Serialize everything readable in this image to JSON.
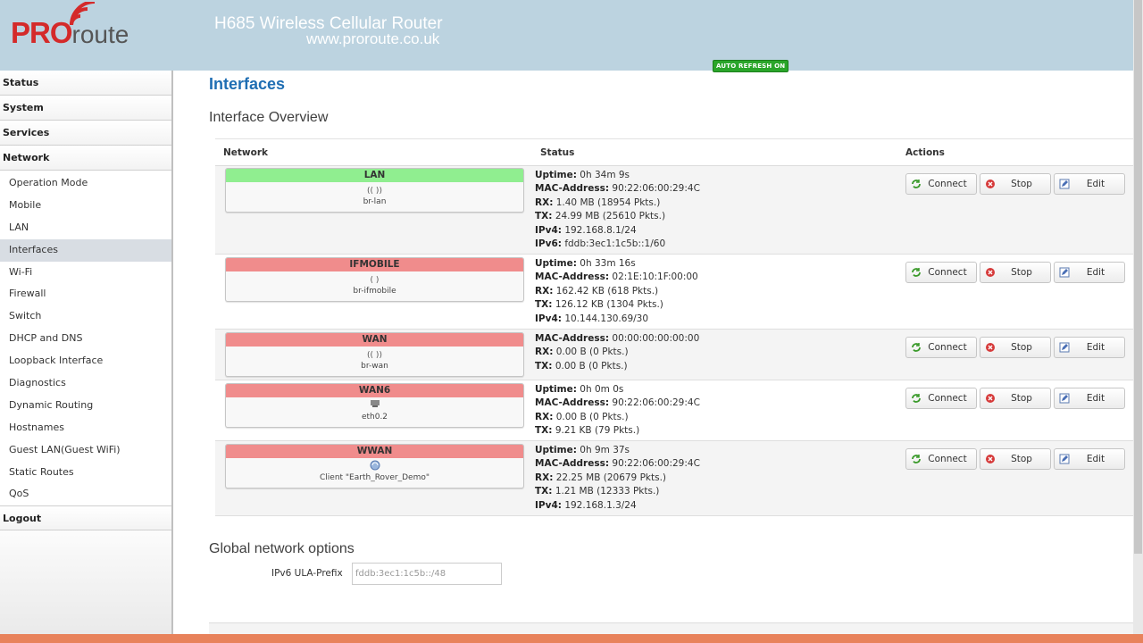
{
  "header": {
    "logo_pro": "PRO",
    "logo_route": "route",
    "title": "H685 Wireless Cellular Router",
    "url": "www.proroute.co.uk",
    "auto_refresh": "AUTO REFRESH ON",
    "colors": {
      "header_bg": "#bcd3e0",
      "brand_red": "#d42a2a",
      "auto_refresh_bg": "#2aa52a"
    }
  },
  "sidebar": {
    "status": "Status",
    "system": "System",
    "services": "Services",
    "network": "Network",
    "network_items": [
      "Operation Mode",
      "Mobile",
      "LAN",
      "Interfaces",
      "Wi-Fi",
      "Firewall",
      "Switch",
      "DHCP and DNS",
      "Loopback Interface",
      "Diagnostics",
      "Dynamic Routing",
      "Hostnames",
      "Guest LAN(Guest WiFi)",
      "Static Routes",
      "QoS"
    ],
    "active_item": "Interfaces",
    "logout": "Logout"
  },
  "main": {
    "page_title": "Interfaces",
    "overview_title": "Interface Overview",
    "columns": {
      "network": "Network",
      "status": "Status",
      "actions": "Actions"
    },
    "buttons": {
      "connect": "Connect",
      "stop": "Stop",
      "edit": "Edit"
    },
    "interfaces": [
      {
        "name": "LAN",
        "head_color": "#90ee90",
        "icons": "(( ))",
        "device": "br-lan",
        "status": [
          {
            "k": "Uptime",
            "v": "0h 34m 9s"
          },
          {
            "k": "MAC-Address",
            "v": "90:22:06:00:29:4C"
          },
          {
            "k": "RX",
            "v": "1.40 MB (18954 Pkts.)"
          },
          {
            "k": "TX",
            "v": "24.99 MB (25610 Pkts.)"
          },
          {
            "k": "IPv4",
            "v": "192.168.8.1/24"
          },
          {
            "k": "IPv6",
            "v": "fddb:3ec1:1c5b::1/60"
          }
        ]
      },
      {
        "name": "IFMOBILE",
        "head_color": "#f08c8c",
        "icons": "( )",
        "device": "br-ifmobile",
        "status": [
          {
            "k": "Uptime",
            "v": "0h 33m 16s"
          },
          {
            "k": "MAC-Address",
            "v": "02:1E:10:1F:00:00"
          },
          {
            "k": "RX",
            "v": "162.42 KB (618 Pkts.)"
          },
          {
            "k": "TX",
            "v": "126.12 KB (1304 Pkts.)"
          },
          {
            "k": "IPv4",
            "v": "10.144.130.69/30"
          }
        ]
      },
      {
        "name": "WAN",
        "head_color": "#f08c8c",
        "icons": "(( ))",
        "device": "br-wan",
        "status": [
          {
            "k": "MAC-Address",
            "v": "00:00:00:00:00:00"
          },
          {
            "k": "RX",
            "v": "0.00 B (0 Pkts.)"
          },
          {
            "k": "TX",
            "v": "0.00 B (0 Pkts.)"
          }
        ]
      },
      {
        "name": "WAN6",
        "head_color": "#f08c8c",
        "icons": "",
        "device": "eth0.2",
        "status": [
          {
            "k": "Uptime",
            "v": "0h 0m 0s"
          },
          {
            "k": "MAC-Address",
            "v": "90:22:06:00:29:4C"
          },
          {
            "k": "RX",
            "v": "0.00 B (0 Pkts.)"
          },
          {
            "k": "TX",
            "v": "9.21 KB (79 Pkts.)"
          }
        ]
      },
      {
        "name": "WWAN",
        "head_color": "#f08c8c",
        "icons": "",
        "device": "Client \"Earth_Rover_Demo\"",
        "status": [
          {
            "k": "Uptime",
            "v": "0h 9m 37s"
          },
          {
            "k": "MAC-Address",
            "v": "90:22:06:00:29:4C"
          },
          {
            "k": "RX",
            "v": "22.25 MB (20679 Pkts.)"
          },
          {
            "k": "TX",
            "v": "1.21 MB (12333 Pkts.)"
          },
          {
            "k": "IPv4",
            "v": "192.168.1.3/24"
          }
        ]
      }
    ],
    "global_title": "Global network options",
    "ula_label": "IPv6 ULA-Prefix",
    "ula_value": "fddb:3ec1:1c5b::/48"
  }
}
